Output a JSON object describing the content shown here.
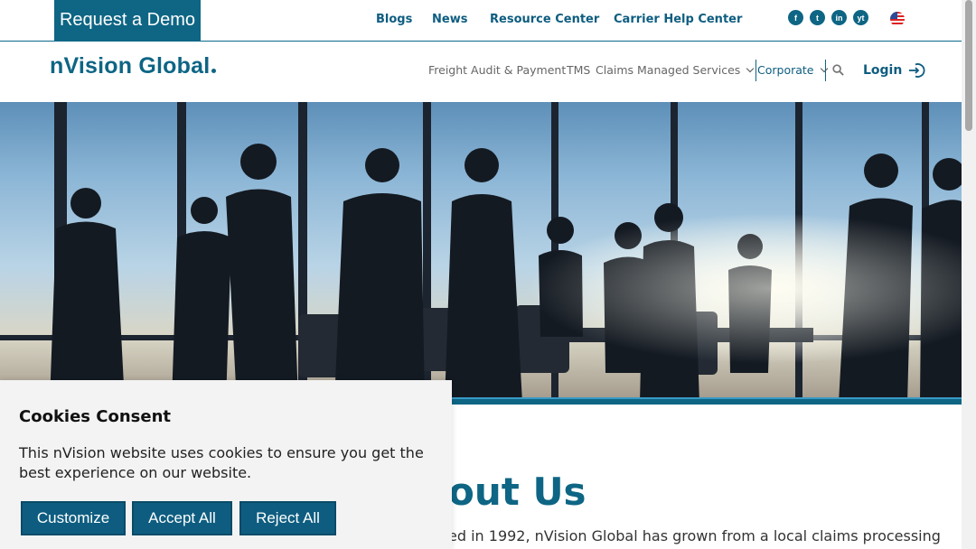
{
  "topbar": {
    "demo_label": "Request a Demo",
    "links": [
      "Blogs",
      "News",
      "Resource Center",
      "Carrier Help Center"
    ],
    "social": [
      "f",
      "t",
      "in",
      "yt"
    ],
    "colors": {
      "brand": "#0e6584",
      "link": "#0e5d80"
    }
  },
  "header": {
    "logo": "nVision Global",
    "nav": [
      "Freight Audit & Payment",
      "TMS",
      "Claims",
      "Managed Services"
    ],
    "corporate": "Corporate",
    "login": "Login"
  },
  "hero": {
    "image_desc": "silhouetted business people in conference room"
  },
  "content": {
    "title": "out Us",
    "text": "ed in 1992, nVision Global has grown from a local claims processing"
  },
  "cookie": {
    "title": "Cookies Consent",
    "text": "This nVision website uses cookies to ensure you get the best experience on our website.",
    "buttons": {
      "customize": "Customize",
      "accept": "Accept All",
      "reject": "Reject All"
    }
  }
}
